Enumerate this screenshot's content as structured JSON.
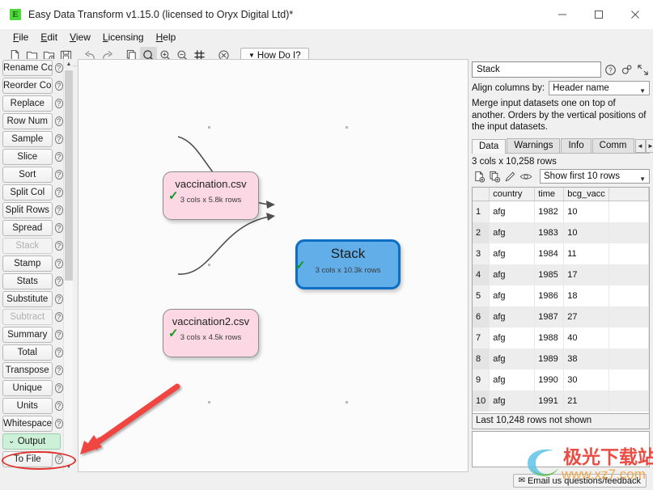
{
  "window": {
    "title": "Easy Data Transform v1.15.0 (licensed to Oryx Digital Ltd)*",
    "app_icon": "E",
    "minimize_label": "Minimize",
    "maximize_label": "Maximize",
    "close_label": "Close"
  },
  "menubar": {
    "items": [
      {
        "label": "File",
        "mnemonic": "F"
      },
      {
        "label": "Edit",
        "mnemonic": "E"
      },
      {
        "label": "View",
        "mnemonic": "V"
      },
      {
        "label": "Licensing",
        "mnemonic": "L"
      },
      {
        "label": "Help",
        "mnemonic": "H"
      }
    ]
  },
  "toolbar": {
    "buttons": [
      {
        "name": "new-icon",
        "title": "New"
      },
      {
        "name": "open-icon",
        "title": "Open"
      },
      {
        "name": "open-recent-icon",
        "title": "Open Recent"
      },
      {
        "name": "save-icon",
        "title": "Save"
      },
      {
        "name": "undo-icon",
        "title": "Undo"
      },
      {
        "name": "redo-icon",
        "title": "Redo"
      },
      {
        "name": "copy-icon",
        "title": "Copy"
      },
      {
        "name": "zoom-fit-icon",
        "title": "Zoom to fit"
      },
      {
        "name": "zoom-in-icon",
        "title": "Zoom In"
      },
      {
        "name": "zoom-out-icon",
        "title": "Zoom Out"
      },
      {
        "name": "grid-icon",
        "title": "Snap to grid"
      },
      {
        "name": "clear-icon",
        "title": "Clear"
      }
    ],
    "how_do_i": "How Do I?"
  },
  "sidebar": {
    "items": [
      {
        "label": "Rename Cols",
        "state": "enabled"
      },
      {
        "label": "Reorder Cols",
        "state": "enabled"
      },
      {
        "label": "Replace",
        "state": "enabled"
      },
      {
        "label": "Row Num",
        "state": "enabled"
      },
      {
        "label": "Sample",
        "state": "enabled"
      },
      {
        "label": "Slice",
        "state": "enabled"
      },
      {
        "label": "Sort",
        "state": "enabled"
      },
      {
        "label": "Split Col",
        "state": "enabled"
      },
      {
        "label": "Split Rows",
        "state": "enabled"
      },
      {
        "label": "Spread",
        "state": "enabled"
      },
      {
        "label": "Stack",
        "state": "disabled"
      },
      {
        "label": "Stamp",
        "state": "enabled"
      },
      {
        "label": "Stats",
        "state": "enabled"
      },
      {
        "label": "Substitute",
        "state": "enabled"
      },
      {
        "label": "Subtract",
        "state": "disabled"
      },
      {
        "label": "Summary",
        "state": "enabled"
      },
      {
        "label": "Total",
        "state": "enabled"
      },
      {
        "label": "Transpose",
        "state": "enabled"
      },
      {
        "label": "Unique",
        "state": "enabled"
      },
      {
        "label": "Units",
        "state": "enabled"
      },
      {
        "label": "Whitespace",
        "state": "enabled"
      },
      {
        "label": "Output",
        "state": "group"
      },
      {
        "label": "To File",
        "state": "enabled"
      }
    ],
    "help_glyph": "?"
  },
  "canvas": {
    "nodes": [
      {
        "id": "n1",
        "type": "input",
        "label": "vaccination.csv",
        "sub": "3 cols x 5.8k rows",
        "status": "ok"
      },
      {
        "id": "n2",
        "type": "input",
        "label": "vaccination2.csv",
        "sub": "3 cols x 4.5k rows",
        "status": "ok"
      },
      {
        "id": "n3",
        "type": "op",
        "label": "Stack",
        "sub": "3 cols x 10.3k rows",
        "status": "ok"
      }
    ],
    "check_glyph": "✓"
  },
  "right_panel": {
    "name_value": "Stack",
    "header_icons": [
      {
        "name": "help-icon",
        "title": "Help"
      },
      {
        "name": "settings-icon",
        "title": "Settings"
      },
      {
        "name": "expand-icon",
        "title": "Expand"
      }
    ],
    "align_label": "Align columns by:",
    "align_value": "Header name",
    "description": "Merge input datasets one on top of another. Orders by the vertical positions of the input datasets.",
    "tabs": [
      {
        "label": "Data",
        "active": true
      },
      {
        "label": "Warnings",
        "active": false
      },
      {
        "label": "Info",
        "active": false
      },
      {
        "label": "Comm",
        "active": false
      }
    ],
    "tab_nav": {
      "prev": "◄",
      "next": "►"
    },
    "row_count": "3 cols x 10,258 rows",
    "data_tools": [
      {
        "name": "copy-to-file-icon",
        "title": "Copy to file"
      },
      {
        "name": "copy-to-clipboard-icon",
        "title": "Copy to clipboard"
      },
      {
        "name": "edit-icon",
        "title": "Edit"
      },
      {
        "name": "view-icon",
        "title": "View"
      }
    ],
    "show_rows_value": "Show first 10 rows",
    "table": {
      "columns": [
        "country",
        "time",
        "bcg_vacc"
      ],
      "rows": [
        {
          "n": "1",
          "country": "afg",
          "time": "1982",
          "bcg_vacc": "10"
        },
        {
          "n": "2",
          "country": "afg",
          "time": "1983",
          "bcg_vacc": "10"
        },
        {
          "n": "3",
          "country": "afg",
          "time": "1984",
          "bcg_vacc": "11"
        },
        {
          "n": "4",
          "country": "afg",
          "time": "1985",
          "bcg_vacc": "17"
        },
        {
          "n": "5",
          "country": "afg",
          "time": "1986",
          "bcg_vacc": "18"
        },
        {
          "n": "6",
          "country": "afg",
          "time": "1987",
          "bcg_vacc": "27"
        },
        {
          "n": "7",
          "country": "afg",
          "time": "1988",
          "bcg_vacc": "40"
        },
        {
          "n": "8",
          "country": "afg",
          "time": "1989",
          "bcg_vacc": "38"
        },
        {
          "n": "9",
          "country": "afg",
          "time": "1990",
          "bcg_vacc": "30"
        },
        {
          "n": "10",
          "country": "afg",
          "time": "1991",
          "bcg_vacc": "21"
        }
      ]
    },
    "not_shown": "Last 10,248 rows not shown"
  },
  "footer": {
    "email_label": "Email us questions/feedback",
    "envelope_glyph": "✉"
  },
  "watermark": {
    "text_cn": "极光下载站",
    "text_url": "www.xz7.com"
  },
  "colors": {
    "accent_blue": "#0d6fc4",
    "node_blue": "#62aee8",
    "node_pink": "#fbd8e3",
    "group_green": "#cdf0d8",
    "annotation_red": "#e0322d",
    "check_green": "#0e9c22"
  }
}
